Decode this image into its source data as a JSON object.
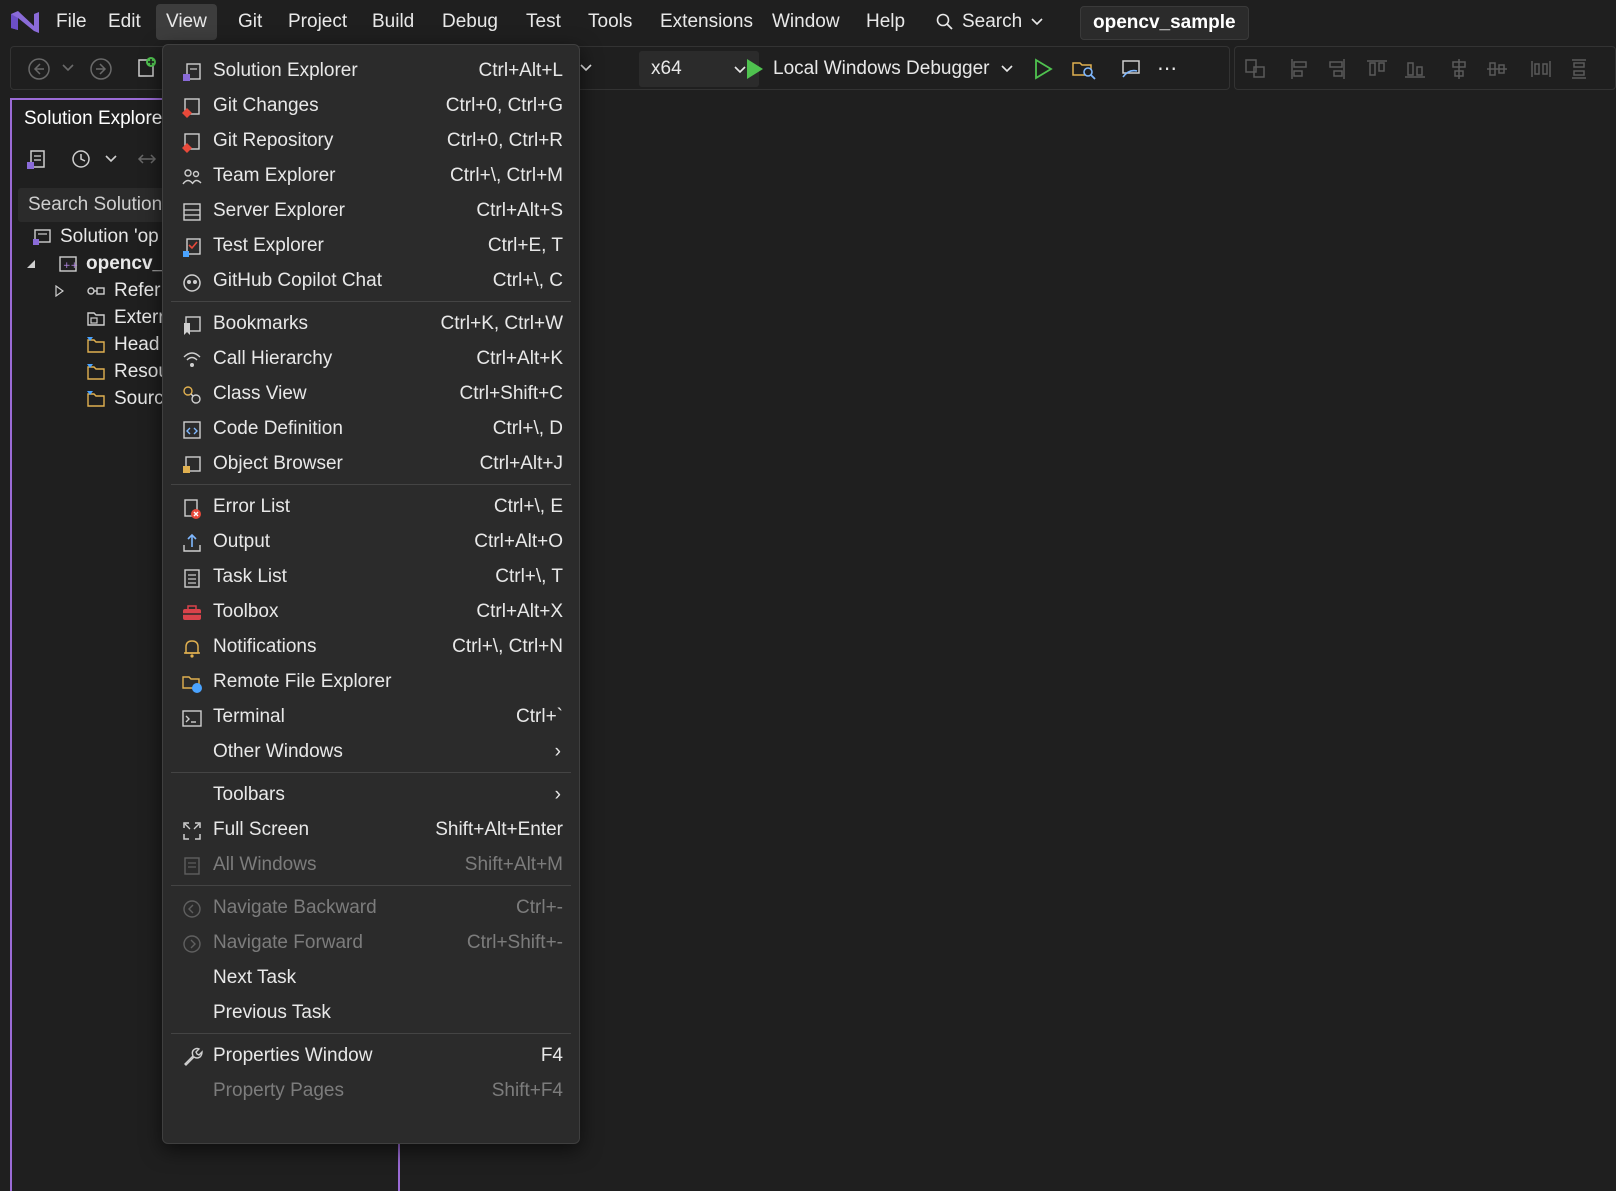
{
  "menubar": {
    "items": [
      "File",
      "Edit",
      "View",
      "Git",
      "Project",
      "Build",
      "Debug",
      "Test",
      "Tools",
      "Extensions",
      "Window",
      "Help"
    ],
    "search_label": "Search",
    "solution_name": "opencv_sample"
  },
  "toolbar": {
    "platform": "x64",
    "debugger": "Local Windows Debugger"
  },
  "solution_explorer": {
    "title": "Solution Explore",
    "search_placeholder": "Search Solution",
    "tree": {
      "solution": "Solution 'op",
      "project": "opencv_",
      "references": "Refer",
      "external": "Exterr",
      "header": "Head",
      "resources": "Resou",
      "source": "Sourc"
    }
  },
  "view_menu": {
    "groups": [
      [
        {
          "label": "Solution Explorer",
          "shortcut": "Ctrl+Alt+L",
          "icon": "solution-explorer-icon"
        },
        {
          "label": "Git Changes",
          "shortcut": "Ctrl+0, Ctrl+G",
          "icon": "git-changes-icon"
        },
        {
          "label": "Git Repository",
          "shortcut": "Ctrl+0, Ctrl+R",
          "icon": "git-repository-icon"
        },
        {
          "label": "Team Explorer",
          "shortcut": "Ctrl+\\, Ctrl+M",
          "icon": "team-explorer-icon"
        },
        {
          "label": "Server Explorer",
          "shortcut": "Ctrl+Alt+S",
          "icon": "server-explorer-icon"
        },
        {
          "label": "Test Explorer",
          "shortcut": "Ctrl+E, T",
          "icon": "test-explorer-icon"
        },
        {
          "label": "GitHub Copilot Chat",
          "shortcut": "Ctrl+\\, C",
          "icon": "copilot-icon"
        }
      ],
      [
        {
          "label": "Bookmarks",
          "shortcut": "Ctrl+K, Ctrl+W",
          "icon": "bookmarks-icon"
        },
        {
          "label": "Call Hierarchy",
          "shortcut": "Ctrl+Alt+K",
          "icon": "call-hierarchy-icon"
        },
        {
          "label": "Class View",
          "shortcut": "Ctrl+Shift+C",
          "icon": "class-view-icon"
        },
        {
          "label": "Code Definition",
          "shortcut": "Ctrl+\\, D",
          "icon": "code-definition-icon"
        },
        {
          "label": "Object Browser",
          "shortcut": "Ctrl+Alt+J",
          "icon": "object-browser-icon"
        }
      ],
      [
        {
          "label": "Error List",
          "shortcut": "Ctrl+\\, E",
          "icon": "error-list-icon"
        },
        {
          "label": "Output",
          "shortcut": "Ctrl+Alt+O",
          "icon": "output-icon"
        },
        {
          "label": "Task List",
          "shortcut": "Ctrl+\\, T",
          "icon": "task-list-icon"
        },
        {
          "label": "Toolbox",
          "shortcut": "Ctrl+Alt+X",
          "icon": "toolbox-icon"
        },
        {
          "label": "Notifications",
          "shortcut": "Ctrl+\\, Ctrl+N",
          "icon": "bell-icon"
        },
        {
          "label": "Remote File Explorer",
          "shortcut": "",
          "icon": "remote-file-explorer-icon"
        },
        {
          "label": "Terminal",
          "shortcut": "Ctrl+`",
          "icon": "terminal-icon"
        },
        {
          "label": "Other Windows",
          "shortcut": "",
          "icon": "",
          "submenu": true
        }
      ],
      [
        {
          "label": "Toolbars",
          "shortcut": "",
          "icon": "",
          "submenu": true
        },
        {
          "label": "Full Screen",
          "shortcut": "Shift+Alt+Enter",
          "icon": "full-screen-icon"
        },
        {
          "label": "All Windows",
          "shortcut": "Shift+Alt+M",
          "icon": "all-windows-icon",
          "disabled": true
        }
      ],
      [
        {
          "label": "Navigate Backward",
          "shortcut": "Ctrl+-",
          "icon": "navigate-backward-icon",
          "disabled": true
        },
        {
          "label": "Navigate Forward",
          "shortcut": "Ctrl+Shift+-",
          "icon": "navigate-forward-icon",
          "disabled": true
        },
        {
          "label": "Next Task",
          "shortcut": "",
          "icon": ""
        },
        {
          "label": "Previous Task",
          "shortcut": "",
          "icon": ""
        }
      ],
      [
        {
          "label": "Properties Window",
          "shortcut": "F4",
          "icon": "wrench-icon"
        },
        {
          "label": "Property Pages",
          "shortcut": "Shift+F4",
          "icon": "",
          "disabled": true
        }
      ]
    ]
  },
  "colors": {
    "accent": "#9b6bd6",
    "menu_bg": "#2b2b2b",
    "app_bg": "#1f1f1f",
    "play_green": "#4fc24f"
  }
}
